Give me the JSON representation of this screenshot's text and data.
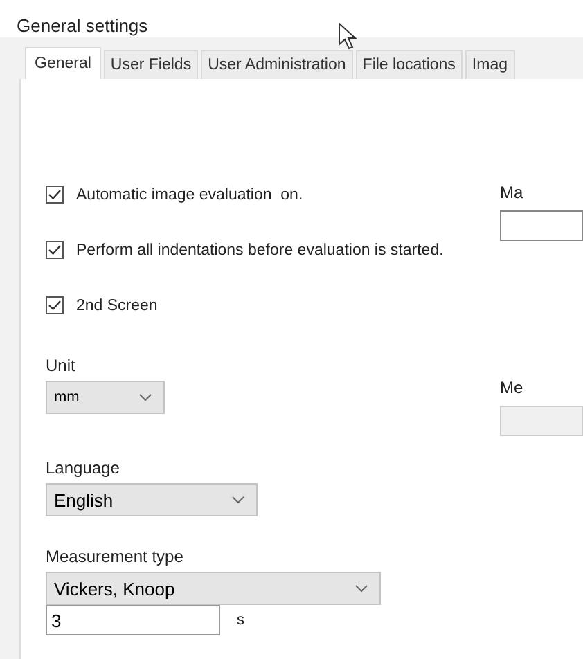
{
  "window": {
    "title": "General settings"
  },
  "tabs": [
    {
      "label": "General",
      "selected": true
    },
    {
      "label": "User Fields",
      "selected": false
    },
    {
      "label": "User Administration",
      "selected": false
    },
    {
      "label": "File locations",
      "selected": false
    },
    {
      "label": "Imag",
      "selected": false
    }
  ],
  "checkboxes": [
    {
      "label": "Automatic image evaluation  on.",
      "checked": true
    },
    {
      "label": "Perform all indentations before evaluation is started.",
      "checked": true
    },
    {
      "label": "2nd Screen",
      "checked": true
    }
  ],
  "unit": {
    "label": "Unit",
    "value": "mm"
  },
  "language": {
    "label": "Language",
    "value": "English"
  },
  "measurement_type": {
    "label": "Measurement type",
    "value": "Vickers, Knoop"
  },
  "time_field": {
    "value": "3",
    "unit": "s"
  },
  "right_column": [
    {
      "label": "Ma",
      "disabled": false
    },
    {
      "label": "Me",
      "disabled": true
    }
  ]
}
